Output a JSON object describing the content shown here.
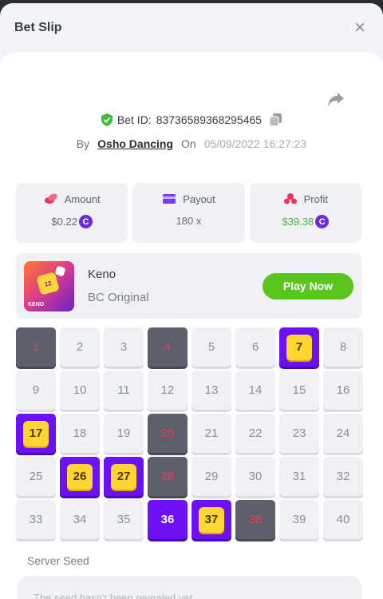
{
  "modal": {
    "title": "Bet Slip",
    "close": "×"
  },
  "bet": {
    "id_label": "Bet ID:",
    "id": "83736589368295465",
    "by_label": "By",
    "user": "Osho Dancing",
    "on_label": "On",
    "date": "05/09/2022 16:27:23"
  },
  "stats": {
    "amount": {
      "label": "Amount",
      "value": "$0.22",
      "icon": "coins-icon"
    },
    "payout": {
      "label": "Payout",
      "value": "180 x",
      "icon": "wallet-icon"
    },
    "profit": {
      "label": "Profit",
      "value": "$39.38",
      "icon": "profit-icon"
    },
    "coin_symbol": "C"
  },
  "game": {
    "name": "Keno",
    "provider": "BC Original",
    "play_label": "Play Now",
    "thumb_text": "12",
    "thumb_brand": "KENO"
  },
  "grid": {
    "cells": [
      {
        "n": "1",
        "state": "miss"
      },
      {
        "n": "2",
        "state": "none"
      },
      {
        "n": "3",
        "state": "none"
      },
      {
        "n": "4",
        "state": "miss"
      },
      {
        "n": "5",
        "state": "none"
      },
      {
        "n": "6",
        "state": "none"
      },
      {
        "n": "7",
        "state": "hit"
      },
      {
        "n": "8",
        "state": "none"
      },
      {
        "n": "9",
        "state": "none"
      },
      {
        "n": "10",
        "state": "none"
      },
      {
        "n": "11",
        "state": "none"
      },
      {
        "n": "12",
        "state": "none"
      },
      {
        "n": "13",
        "state": "none"
      },
      {
        "n": "14",
        "state": "none"
      },
      {
        "n": "15",
        "state": "none"
      },
      {
        "n": "16",
        "state": "none"
      },
      {
        "n": "17",
        "state": "hit"
      },
      {
        "n": "18",
        "state": "none"
      },
      {
        "n": "19",
        "state": "none"
      },
      {
        "n": "20",
        "state": "miss"
      },
      {
        "n": "21",
        "state": "none"
      },
      {
        "n": "22",
        "state": "none"
      },
      {
        "n": "23",
        "state": "none"
      },
      {
        "n": "24",
        "state": "none"
      },
      {
        "n": "25",
        "state": "none"
      },
      {
        "n": "26",
        "state": "hit"
      },
      {
        "n": "27",
        "state": "hit"
      },
      {
        "n": "28",
        "state": "miss"
      },
      {
        "n": "29",
        "state": "none"
      },
      {
        "n": "30",
        "state": "none"
      },
      {
        "n": "31",
        "state": "none"
      },
      {
        "n": "32",
        "state": "none"
      },
      {
        "n": "33",
        "state": "none"
      },
      {
        "n": "34",
        "state": "none"
      },
      {
        "n": "35",
        "state": "none"
      },
      {
        "n": "36",
        "state": "picked"
      },
      {
        "n": "37",
        "state": "hit"
      },
      {
        "n": "38",
        "state": "miss"
      },
      {
        "n": "39",
        "state": "none"
      },
      {
        "n": "40",
        "state": "none"
      }
    ]
  },
  "seed": {
    "label": "Server Seed",
    "value": "The seed hasn't been revealed yet"
  },
  "colors": {
    "accent_purple": "#6c10f5",
    "hit_yellow": "#ffd630",
    "miss_red": "#ef3a4c",
    "play_green": "#5ac51d",
    "profit_green": "#3fbd3f"
  }
}
